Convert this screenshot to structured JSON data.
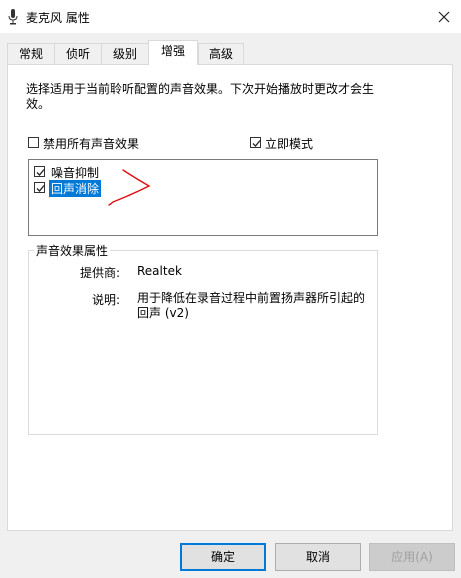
{
  "window": {
    "title": "麦克风 属性"
  },
  "tabs": [
    "常规",
    "侦听",
    "级别",
    "增强",
    "高级"
  ],
  "active_tab": "增强",
  "enhancements": {
    "description": "选择适用于当前聆听配置的声音效果。下次开始播放时更改才会生效。",
    "disable_all_label": "禁用所有声音效果",
    "disable_all_checked": false,
    "immediate_mode_label": "立即模式",
    "immediate_mode_checked": true,
    "effects": [
      {
        "label": "噪音抑制",
        "checked": true,
        "selected": false
      },
      {
        "label": "回声消除",
        "checked": true,
        "selected": true
      }
    ]
  },
  "properties": {
    "group_title": "声音效果属性",
    "provider_label": "提供商:",
    "provider_value": "Realtek",
    "description_label": "说明:",
    "description_value": "用于降低在录音过程中前置扬声器所引起的回声 (v2)"
  },
  "buttons": {
    "ok": "确定",
    "cancel": "取消",
    "apply": "应用(A)"
  },
  "colors": {
    "selection": "#0078d7",
    "annotation": "#e01010"
  }
}
